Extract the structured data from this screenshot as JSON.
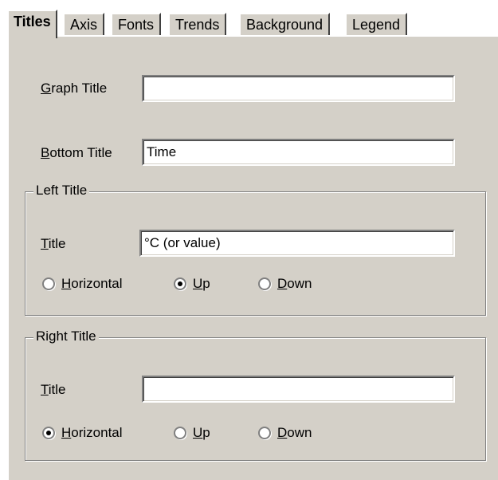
{
  "tabs": [
    {
      "label": "Titles",
      "active": true
    },
    {
      "label": "Axis",
      "active": false
    },
    {
      "label": "Fonts",
      "active": false
    },
    {
      "label": "Trends",
      "active": false
    },
    {
      "label": "Background",
      "active": false
    },
    {
      "label": "Legend",
      "active": false
    }
  ],
  "graph_title": {
    "mnemonic": "G",
    "rest": "raph Title",
    "value": ""
  },
  "bottom_title": {
    "mnemonic": "B",
    "rest": "ottom Title",
    "value": "Time"
  },
  "left_title": {
    "group_label": "Left Title",
    "title_mnemonic": "T",
    "title_rest": "itle",
    "value": "°C (or value)",
    "options": [
      {
        "mnemonic": "H",
        "rest": "orizontal",
        "selected": false
      },
      {
        "mnemonic": "U",
        "rest": "p",
        "selected": true
      },
      {
        "mnemonic": "D",
        "rest": "own",
        "selected": false
      }
    ]
  },
  "right_title": {
    "group_label": "Right Title",
    "title_mnemonic": "T",
    "title_rest": "itle",
    "value": "",
    "options": [
      {
        "mnemonic": "H",
        "rest": "orizontal",
        "selected": true
      },
      {
        "mnemonic": "U",
        "rest": "p",
        "selected": false
      },
      {
        "mnemonic": "D",
        "rest": "own",
        "selected": false
      }
    ]
  }
}
